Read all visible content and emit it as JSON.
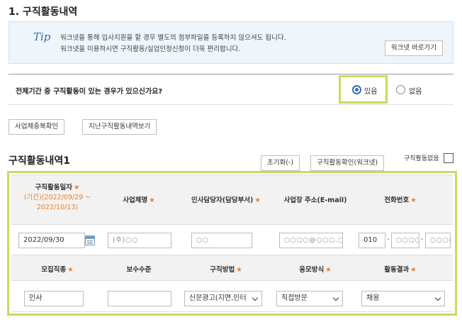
{
  "section": {
    "title": "1. 구직활동내역"
  },
  "tip": {
    "logo": "Tip",
    "line1": "워크넷을 통해 입사지원을 할 경우 별도의 첨부파일을 등록하지 않으셔도 됩니다.",
    "line2": "워크넷을 이용하시면 구직활동/실업인정신청이 더욱 편리합니다.",
    "button": "워크넷 바로가기"
  },
  "question": {
    "text": "전체기간 중 구직활동이 있는 경우가 있으신가요?",
    "option_yes": "있음",
    "option_no": "없음",
    "selected": "있음"
  },
  "action_buttons": {
    "business_check": "사업체중복확인",
    "past_history": "지난구직활동내역보기"
  },
  "activity": {
    "title": "구직활동내역1",
    "reset_button": "초기화(-)",
    "confirm_button": "구직활동확인(워크넷)",
    "no_activity_label": "구직활동없음",
    "headers_row1": {
      "date": "구직활동일자",
      "period": "(기간)(2022/09/29 ~ 2022/10/13)",
      "company": "사업체명",
      "hr_contact": "인사담당자(담당부서)",
      "address": "사업장 주소(E-mail)",
      "phone": "전화번호"
    },
    "headers_row2": {
      "job_type": "모집직종",
      "salary": "보수수준",
      "method": "구직방법",
      "apply_method": "응모방식",
      "result": "활동결과"
    },
    "values": {
      "date": "2022/09/30",
      "company": "(주)○○",
      "hr_contact": "○○",
      "address": "○○○○@○○○.○○",
      "phone_prefix": "010",
      "phone_mid": "○○○○",
      "phone_last": "○○○○",
      "job_type": "인사",
      "salary": "",
      "method": "신문광고(지면,인터",
      "apply_method": "직접방문",
      "result": "채용"
    },
    "required_mark": "★"
  }
}
